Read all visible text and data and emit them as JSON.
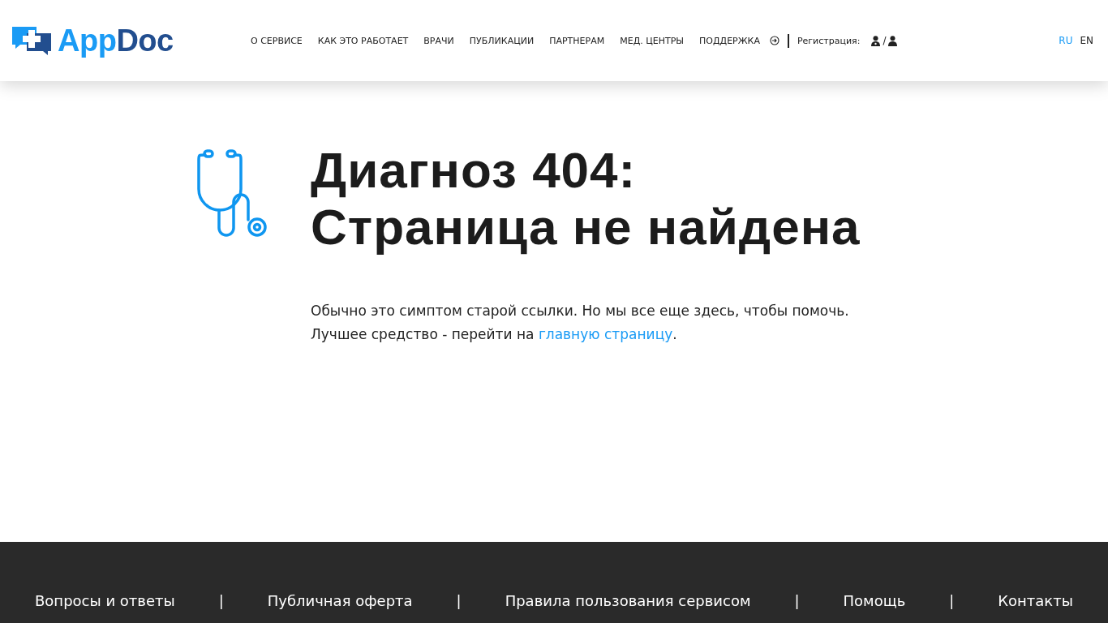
{
  "header": {
    "logo": {
      "part_1": "App",
      "part_2": "Doc"
    },
    "nav": [
      "О СЕРВИСЕ",
      "КАК ЭТО РАБОТАЕТ",
      "ВРАЧИ",
      "ПУБЛИКАЦИИ",
      "ПАРТНЕРАМ",
      "МЕД. ЦЕНТРЫ",
      "ПОДДЕРЖКА"
    ],
    "registration": {
      "label": "Регистрация:",
      "slash": "/"
    },
    "languages": [
      {
        "label": "RU",
        "selected": true
      },
      {
        "label": "EN",
        "selected": false
      }
    ]
  },
  "error": {
    "title_lines": [
      "Диагноз 404:",
      "Страница не найдена"
    ],
    "text_lines": [
      "Обычно это симптом старой ссылки. Но мы все еще здесь, чтобы помочь.",
      "Лучшее средство - перейти на "
    ],
    "link": "главную страницу",
    "text_after": "."
  },
  "footer": {
    "separator": "|",
    "links": [
      "Вопросы и ответы",
      "Публичная оферта",
      "Правила пользования сервисом",
      "Помощь",
      "Контакты"
    ]
  }
}
